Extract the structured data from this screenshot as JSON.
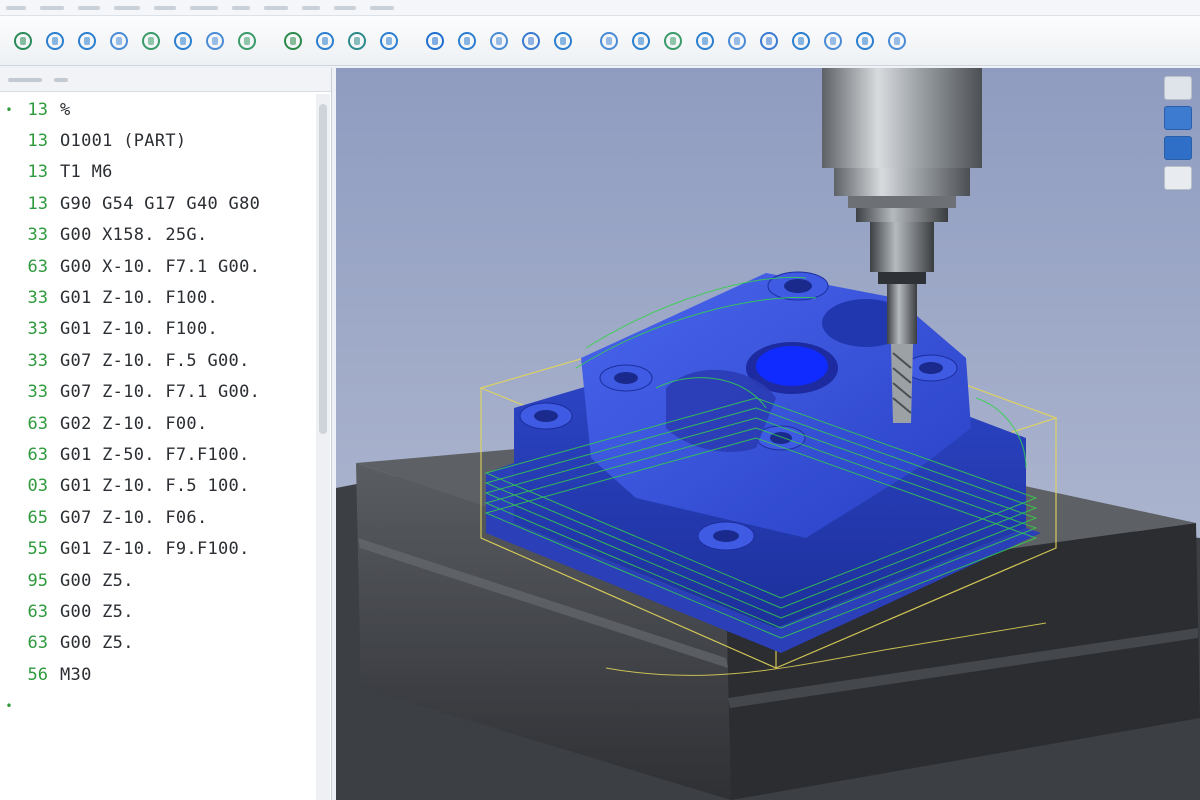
{
  "colors": {
    "accent": "#2e9a3c",
    "part_blue": "#2f4fd8",
    "toolpath_green": "#35d14a",
    "stock_yellow": "#e3d65a",
    "viewport_bg": "#a9b3cd"
  },
  "editor": {
    "lines": [
      {
        "marker": "•",
        "num": "13",
        "code": "%"
      },
      {
        "marker": "",
        "num": "13",
        "code": "O1001 (PART)"
      },
      {
        "marker": "",
        "num": "13",
        "code": "T1 M6"
      },
      {
        "marker": "",
        "num": "13",
        "code": "G90 G54 G17 G40 G80"
      },
      {
        "marker": "",
        "num": "33",
        "code": "G00 X158. 25G."
      },
      {
        "marker": "",
        "num": "63",
        "code": "G00 X-10. F7.1 G00."
      },
      {
        "marker": "",
        "num": "33",
        "code": "G01 Z-10. F100."
      },
      {
        "marker": "",
        "num": "33",
        "code": "G01 Z-10. F100."
      },
      {
        "marker": "",
        "num": "33",
        "code": "G07 Z-10. F.5 G00."
      },
      {
        "marker": "",
        "num": "33",
        "code": "G07 Z-10. F7.1 G00."
      },
      {
        "marker": "",
        "num": "63",
        "code": "G02 Z-10. F00."
      },
      {
        "marker": "",
        "num": "63",
        "code": "G01 Z-50. F7.F100."
      },
      {
        "marker": "",
        "num": "03",
        "code": "G01 Z-10. F.5 100."
      },
      {
        "marker": "",
        "num": "65",
        "code": "G07 Z-10. F06."
      },
      {
        "marker": "",
        "num": "55",
        "code": "G01 Z-10. F9.F100."
      },
      {
        "marker": "",
        "num": "95",
        "code": "G00 Z5."
      },
      {
        "marker": "",
        "num": "63",
        "code": "G00 Z5."
      },
      {
        "marker": "",
        "num": "63",
        "code": "G00 Z5."
      },
      {
        "marker": "",
        "num": "56",
        "code": "M30"
      },
      {
        "marker": "•",
        "num": "",
        "code": ""
      }
    ]
  },
  "toolbar": {
    "buttons": [
      {
        "icon": "open-file-icon"
      },
      {
        "icon": "save-icon"
      },
      {
        "icon": "undo-icon"
      },
      {
        "icon": "redo-icon"
      },
      {
        "icon": "cut-icon"
      },
      {
        "icon": "copy-icon"
      },
      {
        "icon": "paste-icon"
      },
      {
        "icon": "find-icon"
      },
      {
        "icon": "simulate-icon"
      },
      {
        "icon": "verify-icon"
      },
      {
        "icon": "tool-library-icon"
      },
      {
        "icon": "stock-icon"
      },
      {
        "icon": "toolpath-icon"
      },
      {
        "icon": "play-icon"
      },
      {
        "icon": "pause-icon"
      },
      {
        "icon": "stop-icon"
      },
      {
        "icon": "step-icon"
      },
      {
        "icon": "zoom-icon"
      },
      {
        "icon": "rotate-icon"
      },
      {
        "icon": "pan-icon"
      },
      {
        "icon": "fit-view-icon"
      },
      {
        "icon": "iso-view-icon"
      },
      {
        "icon": "top-view-icon"
      },
      {
        "icon": "front-view-icon"
      },
      {
        "icon": "section-icon"
      },
      {
        "icon": "measure-icon"
      },
      {
        "icon": "settings-icon"
      }
    ]
  }
}
